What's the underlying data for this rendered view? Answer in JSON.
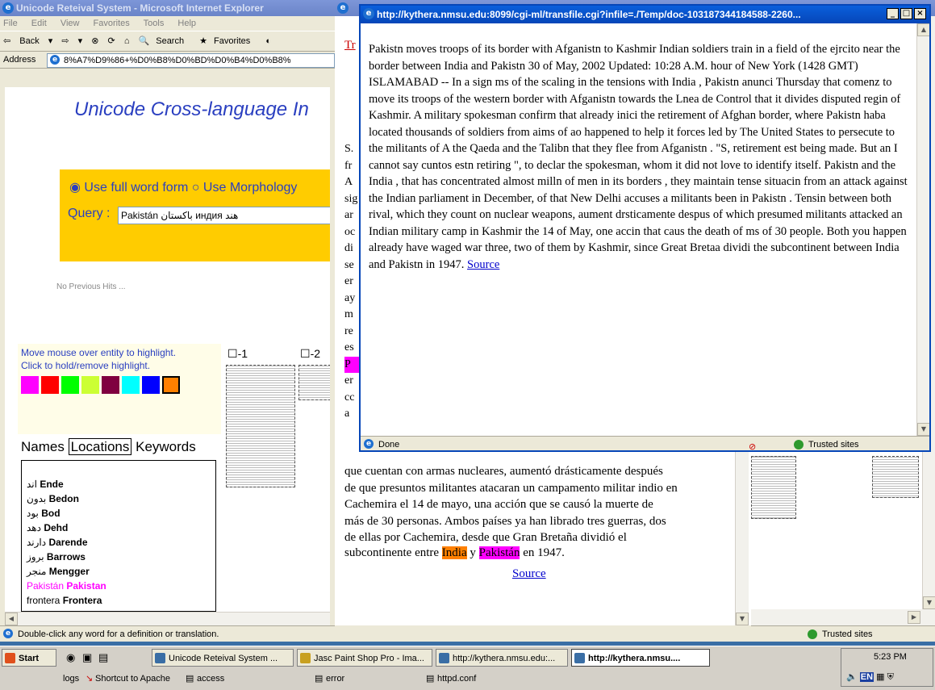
{
  "main_window": {
    "title": "Unicode Reteival System - Microsoft Internet Explorer",
    "menu": [
      "File",
      "Edit",
      "View",
      "Favorites",
      "Tools",
      "Help"
    ],
    "toolbar": {
      "back": "Back",
      "search": "Search",
      "favorites": "Favorites"
    },
    "address_label": "Address",
    "address_value": "8%A7%D9%86+%D0%B8%D0%BD%D0%B4%D0%B8%",
    "heading": "Unicode Cross-language In",
    "option_full": "Use full word form",
    "option_morph": "Use Morphology",
    "query_label": "Query :",
    "query_value": "Pakistán باكستان индия هند",
    "no_hits": "No Previous Hits ...",
    "highlight_help_1": "Move mouse over entity to highlight.",
    "highlight_help_2": "Click to hold/remove highlight.",
    "swatch_colors": [
      "#ff00ff",
      "#ff0000",
      "#00ff00",
      "#ccff33",
      "#800040",
      "#00ffff",
      "#0000ff",
      "#ff8000"
    ],
    "doc_check_1": "-1",
    "doc_check_2": "-2",
    "tabs": [
      "Names",
      "Locations",
      "Keywords"
    ],
    "entities": [
      {
        "native": "اند",
        "en": "Ende",
        "native_color": "#000000"
      },
      {
        "native": "بدون",
        "en": "Bedon",
        "native_color": "#000000"
      },
      {
        "native": "بود",
        "en": "Bod",
        "native_color": "#000000"
      },
      {
        "native": "دهد",
        "en": "Dehd",
        "native_color": "#000000"
      },
      {
        "native": "دارند",
        "en": "Darende",
        "native_color": "#000000"
      },
      {
        "native": "بروز",
        "en": "Barrows",
        "native_color": "#000000"
      },
      {
        "native": "منجر",
        "en": "Mengger",
        "native_color": "#000000"
      },
      {
        "native": "Pakistán",
        "en": "Pakistan",
        "native_color": "#ff00ff"
      },
      {
        "native": "frontera",
        "en": "Frontera",
        "native_color": "#000000"
      }
    ],
    "status": "Double-click any word for a definition or translation."
  },
  "middle_window": {
    "visible_link": "Tr",
    "left_letters": [
      "S.",
      "fr",
      "A",
      "sig",
      "ar",
      "oc",
      "di",
      "se",
      "er",
      "ay",
      "m",
      "re",
      "es",
      "P",
      "er",
      "cc",
      "a"
    ],
    "spanish_lines": [
      "que cuentan con armas nucleares, aumentó drásticamente después",
      "de que presuntos militantes atacaran un campamento militar indio en",
      "Cachemira el 14 de mayo, una acción que se causó la muerte de",
      "más de 30 personas. Ambos países ya han librado tres guerras, dos",
      "de ellas por Cachemira, desde que Gran Bretaña dividió el"
    ],
    "last_line_pre": "subcontinente entre ",
    "india": "India",
    "y": " y ",
    "pakistan": "Pakistán",
    "last_line_post": " en 1947.",
    "source": "Source",
    "right_status": "Trusted sites"
  },
  "popup": {
    "title": "http://kythera.nmsu.edu:8099/cgi-ml/transfile.cgi?infile=./Temp/doc-103187344184588-2260...",
    "text": "Pakistn moves troops of its border with Afganistn to Kashmir Indian soldiers train in a field of the ejrcito near the border between India and Pakistn 30 of May, 2002 Updated: 10:28 A.M. hour of New York (1428 GMT) ISLAMABAD -- In a sign ms of the scaling in the tensions with India , Pakistn anunci Thursday that comenz to move its troops of the western border with Afganistn towards the Lnea de Control that it divides disputed regin of Kashmir. A military spokesman confirm that already inici the retirement of Afghan border, where Pakistn haba located thousands of soldiers from aims of ao happened to help it forces led by The United States to persecute to the militants of A the Qaeda and the Talibn that they flee from Afganistn . \"S, retirement est being made. But an I cannot say cuntos estn retiring \", to declar the spokesman, whom it did not love to identify itself. Pakistn and the India , that has concentrated almost milln of men in its borders , they maintain tense situacin from an attack against the Indian parliament in December, of that New Delhi accuses a militants been in Pakistn . Tensin between both rival, which they count on nuclear weapons, aument drsticamente despus of which presumed militants attacked an Indian military camp in Kashmir the 14 of May, one accin that caus the death of ms of 30 people. Both you happen already have waged war three, two of them by Kashmir, since Great Bretaa dividi the subcontinent between India and Pakistn in 1947.",
    "source": "Source",
    "status_done": "Done",
    "status_zone": "Trusted sites"
  },
  "taskbar": {
    "start": "Start",
    "buttons": [
      "Unicode Reteival System ...",
      "Jasc Paint Shop Pro - Ima...",
      "http://kythera.nmsu.edu:...",
      "http://kythera.nmsu...."
    ],
    "clock": "5:23 PM",
    "lang": "EN",
    "row2": [
      "logs",
      "Shortcut to Apache",
      "access",
      "error",
      "httpd.conf"
    ]
  }
}
